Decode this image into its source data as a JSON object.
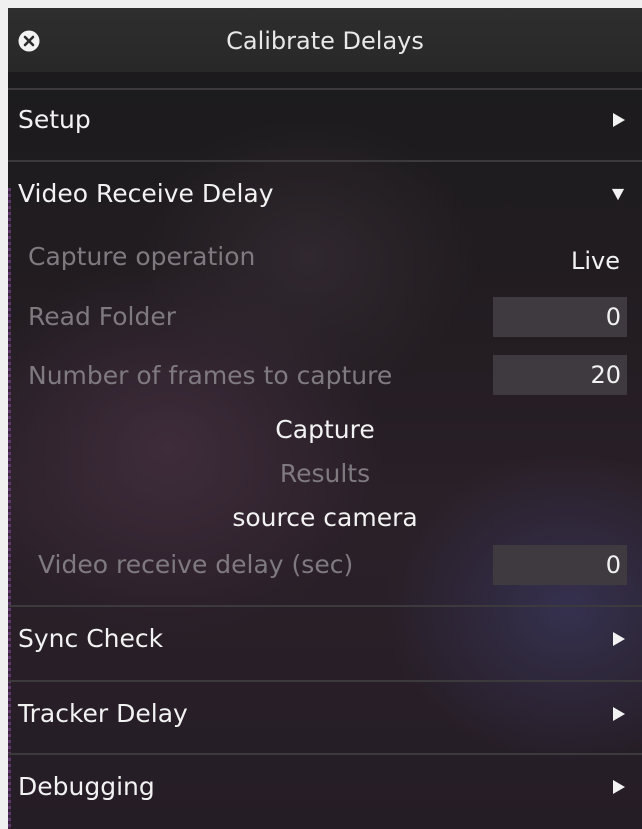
{
  "window": {
    "title": "Calibrate Delays",
    "close_icon": "close-circle-icon"
  },
  "sections": {
    "setup": {
      "label": "Setup",
      "state": "collapsed"
    },
    "video_receive_delay": {
      "label": "Video Receive Delay",
      "state": "expanded"
    },
    "sync_check": {
      "label": "Sync Check",
      "state": "collapsed"
    },
    "tracker_delay": {
      "label": "Tracker Delay",
      "state": "collapsed"
    },
    "debugging": {
      "label": "Debugging",
      "state": "collapsed"
    }
  },
  "video_receive_delay": {
    "capture_operation": {
      "label": "Capture operation",
      "value": "Live"
    },
    "read_folder": {
      "label": "Read Folder",
      "value": "0"
    },
    "frames_to_capture": {
      "label": "Number of frames to capture",
      "value": "20"
    },
    "capture_button": "Capture",
    "results_label": "Results",
    "source_label": "source camera",
    "receive_delay": {
      "label": "Video receive delay (sec)",
      "value": "0"
    }
  },
  "colors": {
    "text_primary": "#f2f2f2",
    "text_dim": "#7f7a80",
    "field_background": "#3f3a3f",
    "title_bar": "#2b2b2b"
  },
  "icons": {
    "collapsed_arrow": "triangle-right-icon",
    "expanded_arrow": "triangle-down-icon"
  }
}
